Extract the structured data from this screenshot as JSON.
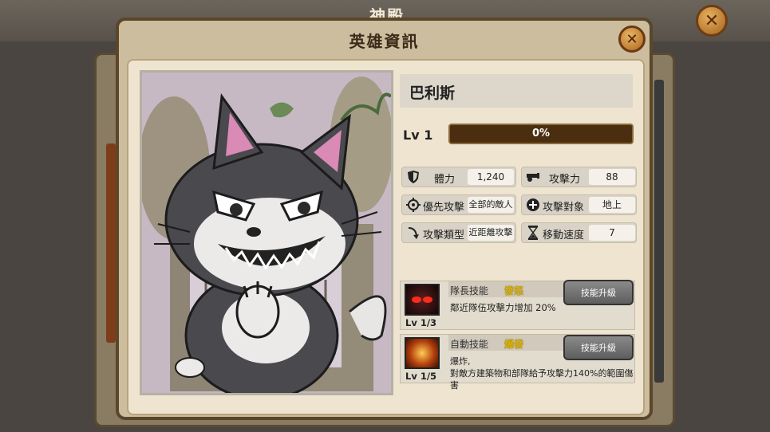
{
  "background": {
    "title": "神殿"
  },
  "dialog": {
    "title": "英雄資訊"
  },
  "hero": {
    "name": "巴利斯",
    "level_label": "Lv 1",
    "exp_progress": 0,
    "exp_text": "0%"
  },
  "stats": [
    {
      "label": "體力",
      "value": "1,240",
      "icon": "shield-icon"
    },
    {
      "label": "攻擊力",
      "value": "88",
      "icon": "cannon-icon"
    },
    {
      "label": "優先攻擊",
      "value": "全部的敵人",
      "icon": "target-icon"
    },
    {
      "label": "攻擊對象",
      "value": "地上",
      "icon": "plus-circle-icon"
    },
    {
      "label": "攻擊類型",
      "value": "近距離攻擊",
      "icon": "arrow-curve-icon"
    },
    {
      "label": "移動速度",
      "value": "7",
      "icon": "hourglass-icon"
    }
  ],
  "skills": [
    {
      "type": "隊長技能",
      "name": "發怒",
      "level": "Lv 1/3",
      "description": "鄰近隊伍攻擊力增加 20%",
      "button": "技能升級"
    },
    {
      "type": "自動技能",
      "name": "爆發",
      "level": "Lv 1/5",
      "description": "爆炸,\n對敵方建築物和部隊給予攻擊力140%的範圍傷害",
      "button": "技能升級"
    }
  ],
  "colors": {
    "accent_gold": "#e0b600",
    "bar_bg": "#4b2e10",
    "panel": "#cbbd9e"
  }
}
